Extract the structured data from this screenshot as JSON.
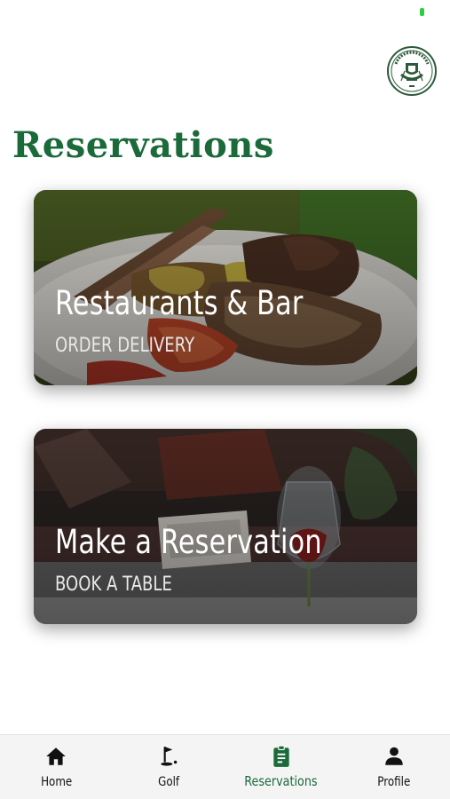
{
  "header": {
    "title": "Reservations",
    "logo_icon": "golf-club-crest-icon",
    "logo_text": "MUTHAIGA GOLF CLUB"
  },
  "cards": [
    {
      "title": "Restaurants & Bar",
      "subtitle": "ORDER DELIVERY",
      "image": "grilled-meat-plate"
    },
    {
      "title": "Make a Reservation",
      "subtitle": "BOOK A TABLE",
      "image": "wine-glass-table-setting"
    }
  ],
  "nav": {
    "items": [
      {
        "label": "Home",
        "icon": "home-icon",
        "active": false
      },
      {
        "label": "Golf",
        "icon": "golf-flag-icon",
        "active": false
      },
      {
        "label": "Reservations",
        "icon": "clipboard-icon",
        "active": true
      },
      {
        "label": "Profile",
        "icon": "person-icon",
        "active": false
      }
    ]
  },
  "colors": {
    "accent": "#1a6a3a",
    "status_indicator": "#2ecc40",
    "nav_background": "#f4f4f4"
  }
}
